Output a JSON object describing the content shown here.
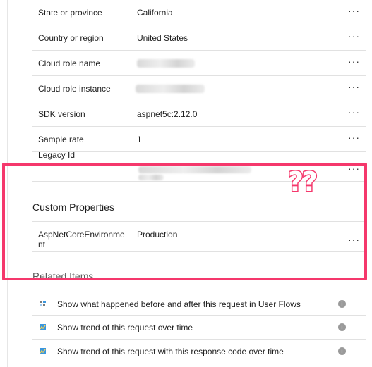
{
  "properties": [
    {
      "key": "State or province",
      "value": "California",
      "blurred": false
    },
    {
      "key": "Country or region",
      "value": "United States",
      "blurred": false
    },
    {
      "key": "Cloud role name",
      "value": "",
      "blurred": true
    },
    {
      "key": "Cloud role instance",
      "value": "",
      "blurred": true
    },
    {
      "key": "SDK version",
      "value": "aspnet5c:2.12.0",
      "blurred": false
    },
    {
      "key": "Sample rate",
      "value": "1",
      "blurred": false
    }
  ],
  "legacy": {
    "key": "Legacy Id"
  },
  "more_label": "···",
  "custom_section": {
    "title": "Custom Properties",
    "rows": [
      {
        "key": "AspNetCoreEnvironment",
        "value": "Production"
      }
    ]
  },
  "related_section": {
    "title": "Related Items",
    "items": [
      {
        "label": "Show what happened before and after this request in User Flows",
        "icon": "user-flows-icon"
      },
      {
        "label": "Show trend of this request over time",
        "icon": "trend-chart-icon"
      },
      {
        "label": "Show trend of this request with this response code over time",
        "icon": "trend-chart-icon"
      }
    ]
  },
  "annotation": {
    "text": "??",
    "color": "#f5386c"
  }
}
